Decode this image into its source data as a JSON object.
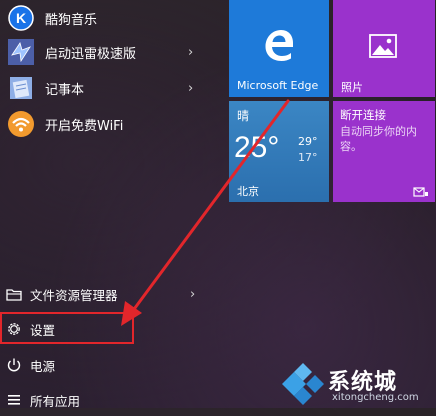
{
  "apps": [
    {
      "label": "酷狗音乐",
      "icon": "kugou-music-icon",
      "color": "#1a73e8"
    },
    {
      "label": "启动迅雷极速版",
      "icon": "xunlei-icon",
      "color": "#5a7bd8",
      "has_submenu": true,
      "chevron": "›"
    },
    {
      "label": "记事本",
      "icon": "notepad-icon",
      "color": "#6b8fd0",
      "has_submenu": true,
      "chevron": "›"
    },
    {
      "label": "开启免费WiFi",
      "icon": "wifi-icon",
      "color": "#f29a2e"
    }
  ],
  "bottom_menu": [
    {
      "label": "文件资源管理器",
      "icon": "file-explorer-icon",
      "has_submenu": true,
      "chevron": "›"
    },
    {
      "label": "设置",
      "icon": "gear-icon"
    },
    {
      "label": "电源",
      "icon": "power-icon"
    },
    {
      "label": "所有应用",
      "icon": "all-apps-icon"
    }
  ],
  "tiles": {
    "edge": {
      "label": "Microsoft Edge",
      "color": "#1e7ad9"
    },
    "photos": {
      "label": "照片",
      "color": "#9a32cc"
    },
    "weather": {
      "condition": "晴",
      "temp": "25°",
      "high": "29°",
      "low": "17°",
      "city": "北京",
      "color": "#2f78b8"
    },
    "mail": {
      "title": "断开连接",
      "message": "自动同步你的内容。",
      "color": "#9a32cc"
    }
  },
  "annotation_color": "#e2262b",
  "watermark": {
    "brand": "系统城",
    "url": "xitongcheng.com"
  }
}
